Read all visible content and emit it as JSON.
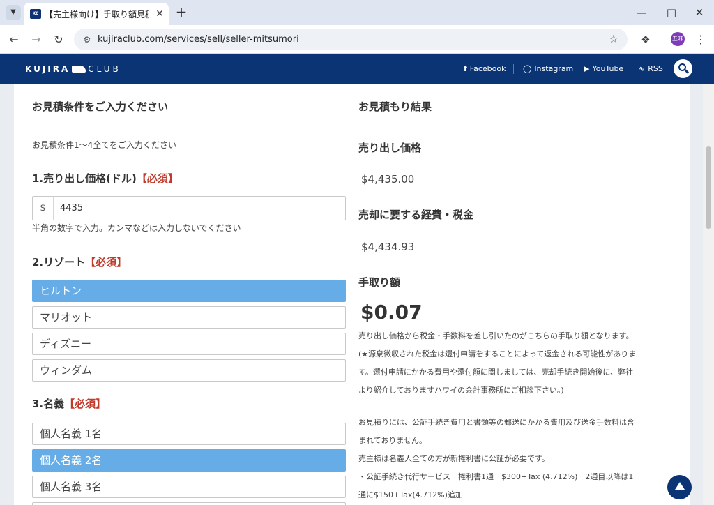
{
  "browser": {
    "tab_title": "【売主様向け】手取り額見積りツー",
    "new_tab": "+",
    "address": "kujiraclub.com/services/sell/seller-mitsumori",
    "profile_label": "五味"
  },
  "site": {
    "logo_main": "KUJIRA",
    "logo_sub": "CLUB",
    "social": [
      {
        "icon": "facebook-icon",
        "label": "Facebook"
      },
      {
        "icon": "instagram-icon",
        "label": "Instagram"
      },
      {
        "icon": "youtube-icon",
        "label": "YouTube"
      },
      {
        "icon": "rss-icon",
        "label": "RSS"
      }
    ],
    "brand_color": "#0a3474"
  },
  "form": {
    "heading": "お見積条件をご入力ください",
    "instruction": "お見積条件1～4全てをご入力ください",
    "required_mark": "【必須】",
    "price": {
      "label": "1.売り出し価格(ドル)",
      "prefix": "$",
      "value": "4435",
      "help": "半角の数字で入力。カンマなどは入力しないでください"
    },
    "resort": {
      "label": "2.リゾート",
      "options": [
        "ヒルトン",
        "マリオット",
        "ディズニー",
        "ウィンダム"
      ],
      "selected": "ヒルトン"
    },
    "owner": {
      "label": "3.名義",
      "options": [
        "個人名義 1名",
        "個人名義 2名",
        "個人名義 3名"
      ],
      "selected": "個人名義 2名"
    },
    "selected_color": "#66ade8"
  },
  "result": {
    "heading": "お見積もり結果",
    "sale_price_label": "売り出し価格",
    "sale_price": "$4,435.00",
    "costs_label": "売却に要する経費・税金",
    "costs": "$4,434.93",
    "net_label": "手取り額",
    "net": "$0.07",
    "para1": [
      "売り出し価格から税金・手数料を差し引いたのがこちらの手取り額となります。",
      "(★源泉徴収された税金は還付申請をすることによって返金される可能性がありま",
      "す。還付申請にかかる費用や還付額に関しましては、売却手続き開始後に、弊社",
      "より紹介しておりますハワイの会計事務所にご相談下さい。)"
    ],
    "para2": [
      "お見積りには、公証手続き費用と書類等の郵送にかかる費用及び送金手数料は含",
      "まれておりません。",
      "売主様は名義人全ての方が新権利書に公証が必要です。",
      "・公証手続き代行サービス　権利書1通　$300+Tax (4.712%)　2通目以降は1",
      "通に$150+Tax(4.712%)追加"
    ]
  }
}
